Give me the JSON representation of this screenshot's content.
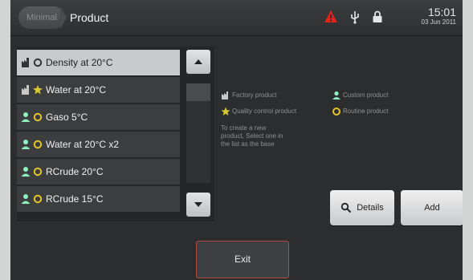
{
  "header": {
    "breadcrumb_home": "Minimal",
    "title": "Product",
    "time": "15:01",
    "date": "03 Jun 2011",
    "status_icons": [
      "warning-icon",
      "usb-icon",
      "lock-icon"
    ],
    "warning_color": "#e2231a"
  },
  "products": [
    {
      "label": "Density at 20°C",
      "type_icon": "factory-icon",
      "status_icon": "routine-icon",
      "selected": true
    },
    {
      "label": "Water at 20°C",
      "type_icon": "factory-icon",
      "status_icon": "star-icon",
      "selected": false
    },
    {
      "label": "Gaso 5°C",
      "type_icon": "user-icon",
      "status_icon": "routine-icon",
      "selected": false
    },
    {
      "label": "Water at 20°C x2",
      "type_icon": "user-icon",
      "status_icon": "routine-icon",
      "selected": false
    },
    {
      "label": "RCrude 20°C",
      "type_icon": "user-icon",
      "status_icon": "routine-icon",
      "selected": false
    },
    {
      "label": "RCrude 15°C",
      "type_icon": "user-icon",
      "status_icon": "routine-icon",
      "selected": false
    }
  ],
  "legend": {
    "factory": "Factory product",
    "custom": "Custom product",
    "quality": "Quality control product",
    "routine": "Routine product",
    "hint": "To create a new product, Select one in the list as the base"
  },
  "buttons": {
    "details": "Details",
    "add": "Add",
    "exit": "Exit"
  },
  "colors": {
    "star": "#d7c832",
    "routine": "#e3c52a",
    "user": "#8ff0c0",
    "factory": "#c8c8c8"
  }
}
